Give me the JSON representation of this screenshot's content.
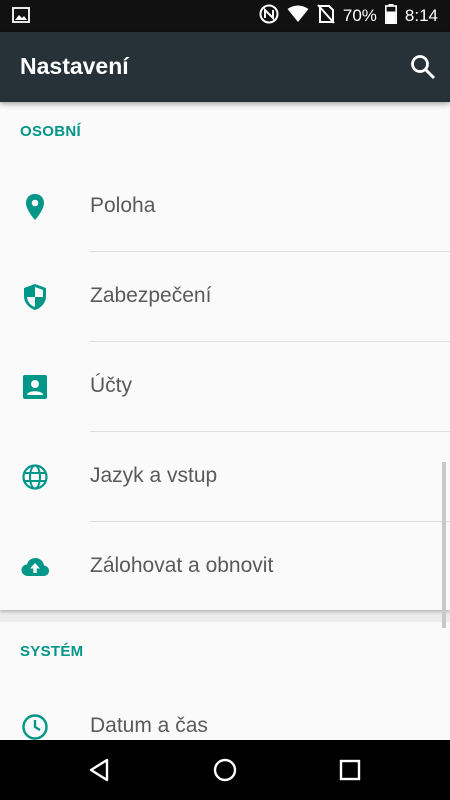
{
  "status_bar": {
    "battery_percent": "70%",
    "time": "8:14",
    "icons": [
      "image-icon",
      "nfc-icon",
      "wifi-icon",
      "no-sim-icon",
      "battery-icon"
    ]
  },
  "app_bar": {
    "title": "Nastavení",
    "search_icon": "search-icon"
  },
  "sections": [
    {
      "header": "OSOBNÍ",
      "items": [
        {
          "label": "Poloha",
          "icon": "location-icon"
        },
        {
          "label": "Zabezpečení",
          "icon": "shield-icon"
        },
        {
          "label": "Účty",
          "icon": "account-icon"
        },
        {
          "label": "Jazyk a vstup",
          "icon": "globe-icon"
        },
        {
          "label": "Zálohovat a obnovit",
          "icon": "cloud-upload-icon"
        }
      ]
    },
    {
      "header": "SYSTÉM",
      "items": [
        {
          "label": "Datum a čas",
          "icon": "clock-icon"
        }
      ]
    }
  ],
  "nav_bar": {
    "buttons": [
      "back-icon",
      "home-icon",
      "recents-icon"
    ]
  },
  "colors": {
    "accent": "#009688",
    "app_bar": "#263238",
    "status_bar": "#111111",
    "text_primary": "#5a5a5a"
  }
}
